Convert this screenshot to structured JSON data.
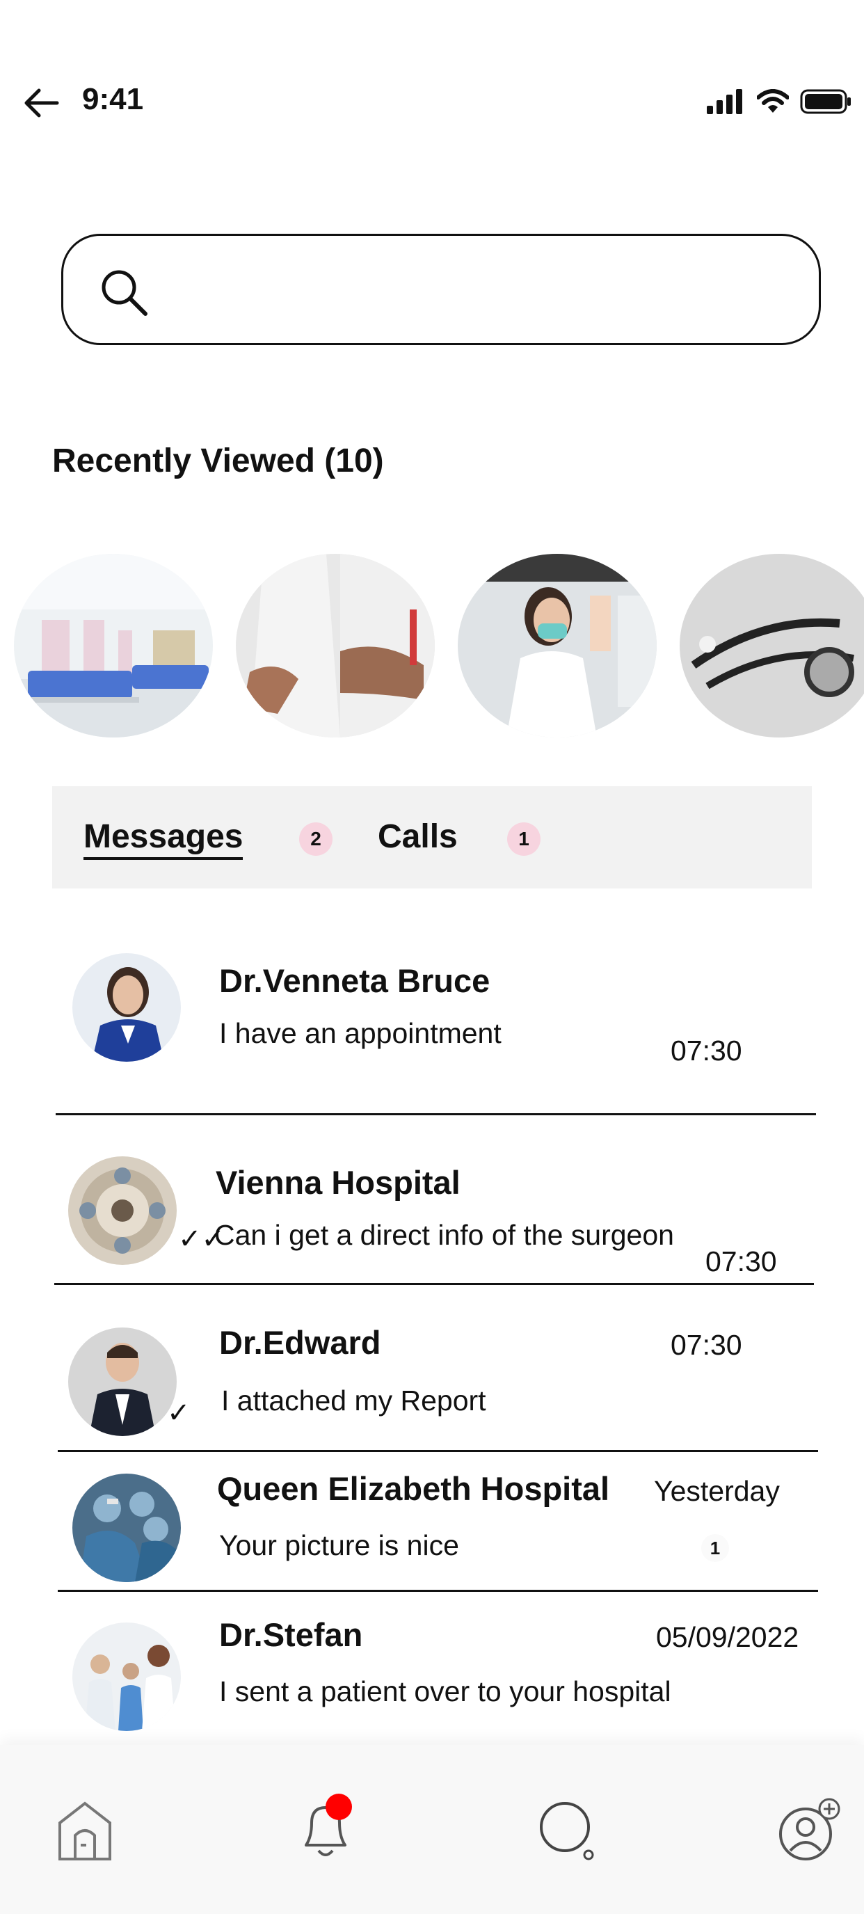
{
  "status_bar": {
    "time": "9:41"
  },
  "search": {
    "placeholder": ""
  },
  "recently_viewed": {
    "title": "Recently Viewed (10)",
    "items": [
      {
        "icon": "hospital-ward-photo"
      },
      {
        "icon": "doctor-coat-photo"
      },
      {
        "icon": "lab-researcher-photo"
      },
      {
        "icon": "stethoscope-photo"
      }
    ]
  },
  "tabs": {
    "messages_label": "Messages",
    "messages_count": "2",
    "calls_label": "Calls",
    "calls_count": "1"
  },
  "chats": [
    {
      "name": "Dr.Venneta Bruce",
      "message": "I have an appointment",
      "time": "07:30"
    },
    {
      "name": "Vienna Hospital",
      "message": "Can i get a direct info of the surgeon",
      "time": "07:30",
      "status": "read"
    },
    {
      "name": "Dr.Edward",
      "message": "I attached my Report",
      "time": "07:30",
      "status": "sent"
    },
    {
      "name": "Queen Elizabeth Hospital",
      "message": "Your picture is nice",
      "time": "Yesterday",
      "unread": "1"
    },
    {
      "name": "Dr.Stefan",
      "message": "I sent a patient over to your hospital",
      "time": "05/09/2022"
    }
  ],
  "colors": {
    "badge_bg": "#f7d4df",
    "notification_dot": "#ff0000",
    "tabbar_bg": "#f2f2f2"
  }
}
